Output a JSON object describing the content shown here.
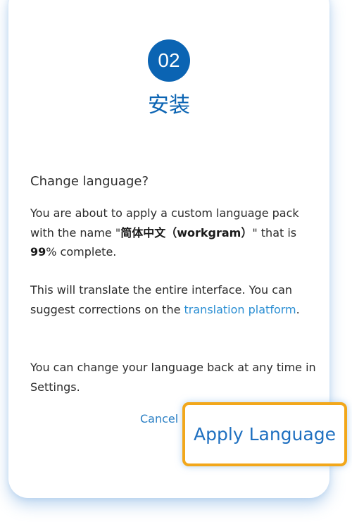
{
  "step": {
    "number": "02",
    "title": "安装"
  },
  "dialog": {
    "heading": "Change language?",
    "p1": {
      "pre": "You are about to apply a custom language pack with the name \"",
      "pack_name": "简体中文（workgram）",
      "mid": "\" that is ",
      "percent": "99",
      "post": "% complete."
    },
    "p2": {
      "pre": "This will translate the entire interface. You can suggest corrections on the ",
      "link": "translation platform",
      "post": "."
    },
    "p3": "You can change your language back at any time in Settings.",
    "cancel_label": "Cancel",
    "apply_label": "Apply Language"
  },
  "colors": {
    "accent": "#0b64b3",
    "link": "#2a8ed3",
    "highlight": "#f2a71b"
  }
}
